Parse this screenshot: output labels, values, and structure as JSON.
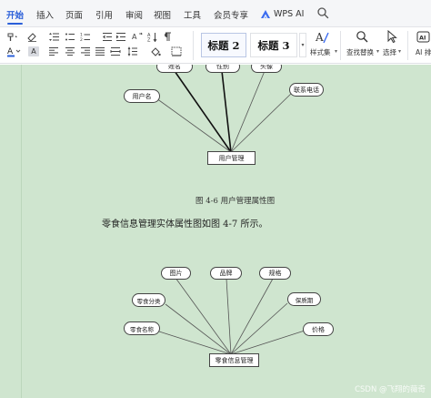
{
  "menu": {
    "items": [
      "开始",
      "插入",
      "页面",
      "引用",
      "审阅",
      "视图",
      "工具",
      "会员专享"
    ],
    "active": "开始",
    "ai_label": "WPS AI"
  },
  "ribbon": {
    "styles": [
      "标题 2",
      "标题 3"
    ],
    "style_set_label": "样式集",
    "find_replace_label": "查找替换",
    "select_label": "选择",
    "ai_layout_label": "AI 排"
  },
  "document": {
    "diagram1": {
      "attributes": [
        "姓名",
        "性别",
        "头像",
        "用户名",
        "联系电话"
      ],
      "entity": "用户管理"
    },
    "caption1": "图 4-6 用户管理属性图",
    "body_text": "零食信息管理实体属性图如图 4-7 所示。",
    "diagram2": {
      "attributes": [
        "图片",
        "品牌",
        "规格",
        "零食分类",
        "保质期",
        "零食名称",
        "价格"
      ],
      "entity": "零食信息管理"
    }
  },
  "watermark": "CSDN @飞翔的薇奇",
  "colors": {
    "accent": "#2b5fd9",
    "doc_background": "#cfe5cf",
    "ai_icon": "#3b6cf0"
  }
}
